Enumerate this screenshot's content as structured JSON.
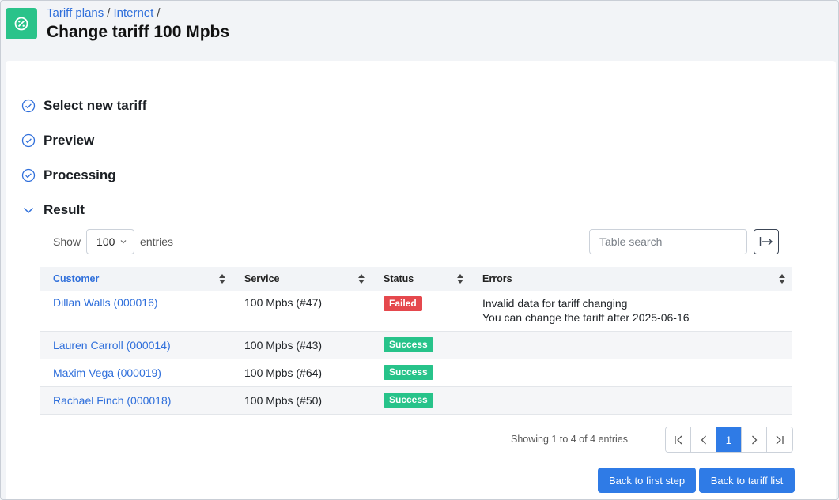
{
  "header": {
    "breadcrumb": [
      "Tariff plans",
      "Internet"
    ],
    "title": "Change tariff 100 Mpbs"
  },
  "steps": [
    {
      "label": "Select new tariff",
      "state": "done"
    },
    {
      "label": "Preview",
      "state": "done"
    },
    {
      "label": "Processing",
      "state": "done"
    },
    {
      "label": "Result",
      "state": "expanded"
    }
  ],
  "table_controls": {
    "show_label": "Show",
    "entries_value": "100",
    "entries_label": "entries",
    "search_placeholder": "Table search"
  },
  "table": {
    "columns": [
      "Customer",
      "Service",
      "Status",
      "Errors"
    ],
    "rows": [
      {
        "customer": "Dillan Walls (000016)",
        "service": "100 Mpbs (#47)",
        "status": "Failed",
        "errors": [
          "Invalid data for tariff changing",
          "You can change the tariff after 2025-06-16"
        ]
      },
      {
        "customer": "Lauren Carroll (000014)",
        "service": "100 Mpbs (#43)",
        "status": "Success",
        "errors": []
      },
      {
        "customer": "Maxim Vega (000019)",
        "service": "100 Mpbs (#64)",
        "status": "Success",
        "errors": []
      },
      {
        "customer": "Rachael Finch (000018)",
        "service": "100 Mpbs (#50)",
        "status": "Success",
        "errors": []
      }
    ]
  },
  "pagination": {
    "info": "Showing 1 to 4 of 4 entries",
    "current_page": "1"
  },
  "actions": {
    "back_first": "Back to first step",
    "back_list": "Back to tariff list"
  },
  "colors": {
    "accent": "#2f7be6",
    "link": "#2f6fdb",
    "success": "#27c38a",
    "failed": "#e5484d",
    "app_icon": "#2ac38a"
  }
}
